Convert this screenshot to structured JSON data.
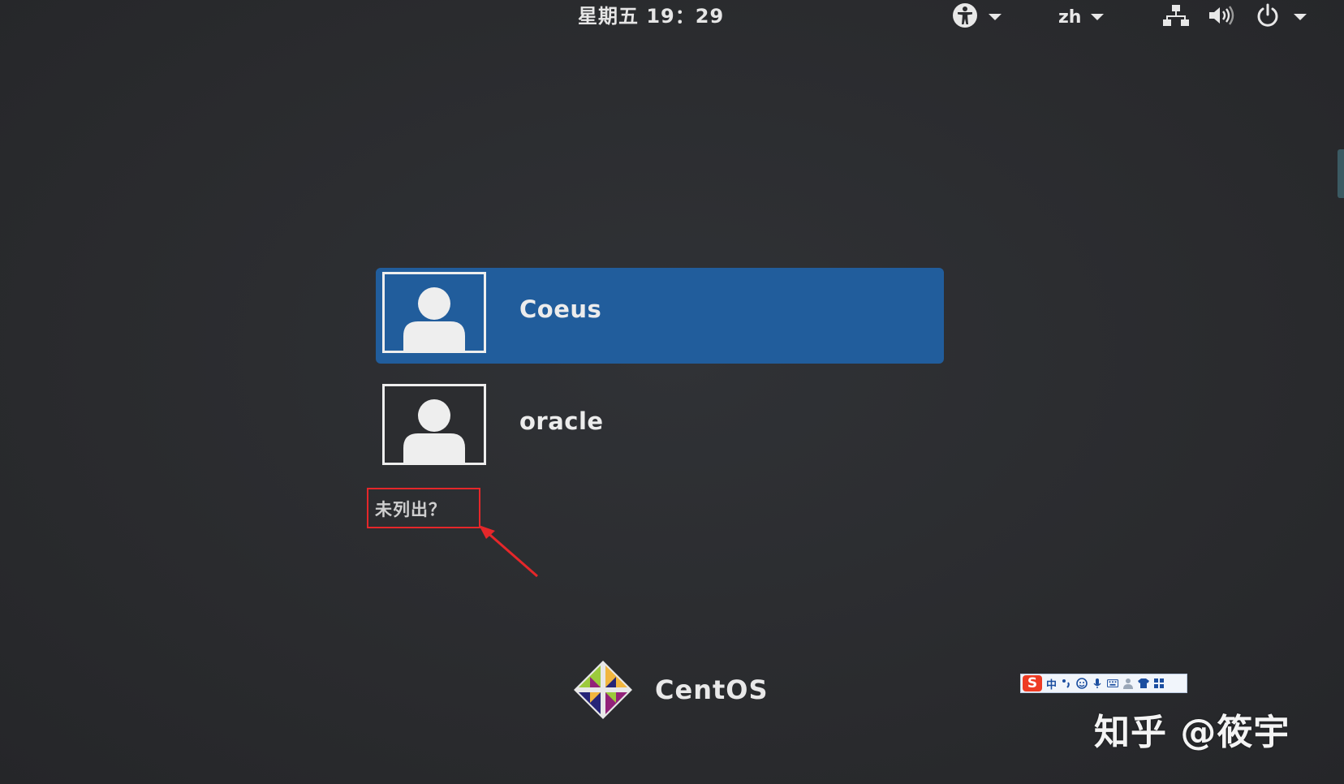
{
  "topbar": {
    "clock": "星期五 19：29",
    "language": "zh",
    "icons": [
      "accessibility-icon",
      "network-icon",
      "volume-icon",
      "power-icon"
    ]
  },
  "users": [
    {
      "name": "Coeus",
      "selected": true
    },
    {
      "name": "oracle",
      "selected": false
    }
  ],
  "not_listed_label": "未列出？",
  "logo": {
    "text": "CentOS"
  },
  "ime": {
    "logo": "S",
    "mode": "中",
    "icons": [
      "punctuation-icon",
      "emoji-icon",
      "microphone-icon",
      "keyboard-icon",
      "user-icon",
      "skin-icon",
      "menu-grid-icon"
    ]
  },
  "watermark": "知乎 @筱宇",
  "colors": {
    "background": "#2b2c2f",
    "selection": "#215d9c",
    "annotation_red": "#e5272a",
    "ime_red": "#ee3b24"
  }
}
